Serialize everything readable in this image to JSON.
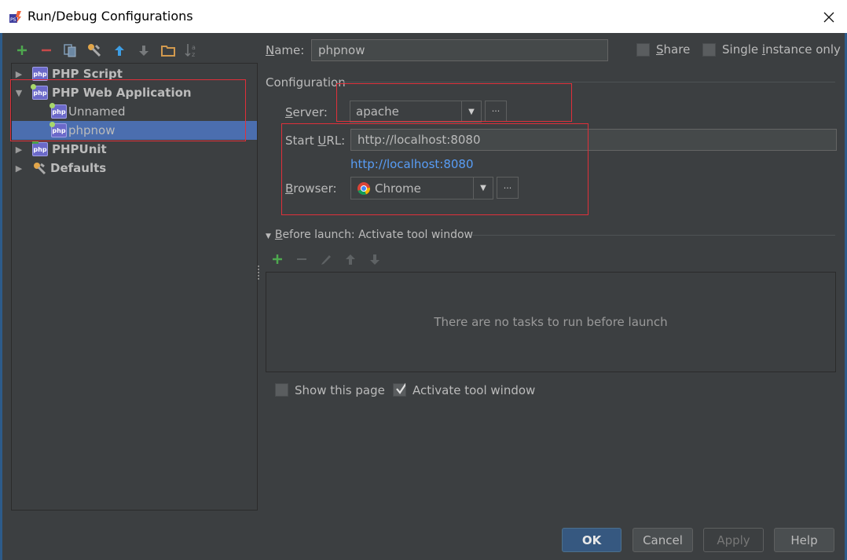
{
  "window": {
    "title": "Run/Debug Configurations"
  },
  "toolbar": {
    "items": [
      "add",
      "remove",
      "copy",
      "edit-defaults",
      "move-up",
      "move-down",
      "folder",
      "sort"
    ]
  },
  "tree": {
    "items": [
      {
        "label": "PHP Script",
        "expanded": false,
        "level": 0
      },
      {
        "label": "PHP Web Application",
        "expanded": true,
        "level": 0
      },
      {
        "label": "Unnamed",
        "level": 1
      },
      {
        "label": "phpnow",
        "level": 1,
        "selected": true
      },
      {
        "label": "PHPUnit",
        "expanded": false,
        "level": 0
      },
      {
        "label": "Defaults",
        "expanded": false,
        "level": 0
      }
    ]
  },
  "form": {
    "name_label_u": "N",
    "name_label_rest": "ame:",
    "name_value": "phpnow",
    "share_u": "S",
    "share_rest": "hare",
    "share_checked": false,
    "single_pre": "Single ",
    "single_u": "i",
    "single_rest": "nstance only",
    "single_checked": false,
    "configuration_title": "Configuration",
    "server_u": "S",
    "server_rest": "erver:",
    "server_value": "apache",
    "url_pre": "Start ",
    "url_u": "U",
    "url_rest": "RL:",
    "url_value": "http://localhost:8080",
    "url_link": "http://localhost:8080",
    "browser_u": "B",
    "browser_rest": "rowser:",
    "browser_value": "Chrome",
    "ellipsis": "···"
  },
  "before_launch": {
    "title_u": "B",
    "title_rest": "efore launch: Activate tool window",
    "empty_text": "There are no tasks to run before launch",
    "show_page_label": "Show this page",
    "show_page_checked": false,
    "activate_label": "Activate tool window",
    "activate_checked": true
  },
  "buttons": {
    "ok": "OK",
    "cancel": "Cancel",
    "apply": "Apply",
    "help": "Help"
  },
  "colors": {
    "accent": "#4b6eaf",
    "link": "#589df6",
    "annotation": "#e0303a"
  }
}
